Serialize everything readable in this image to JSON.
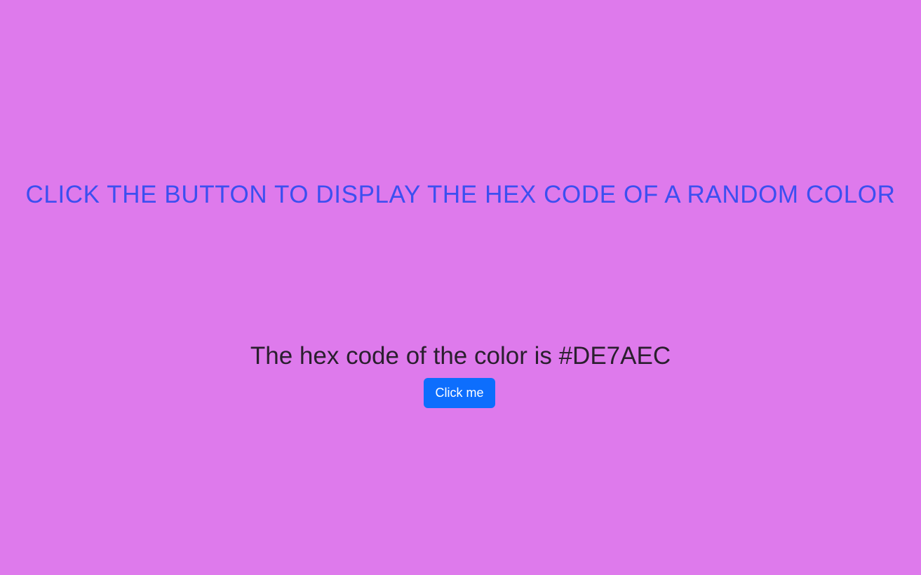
{
  "theme": {
    "background_color": "#DE7AEC",
    "headline_color": "#3C4FF0",
    "button_color": "#0D6EFD"
  },
  "headline": {
    "text": "CLICK THE BUTTON TO DISPLAY THE HEX CODE OF A RANDOM COLOR"
  },
  "result": {
    "prefix": "The hex code of the color is ",
    "hex": "#DE7AEC"
  },
  "button": {
    "label": "Click me"
  }
}
